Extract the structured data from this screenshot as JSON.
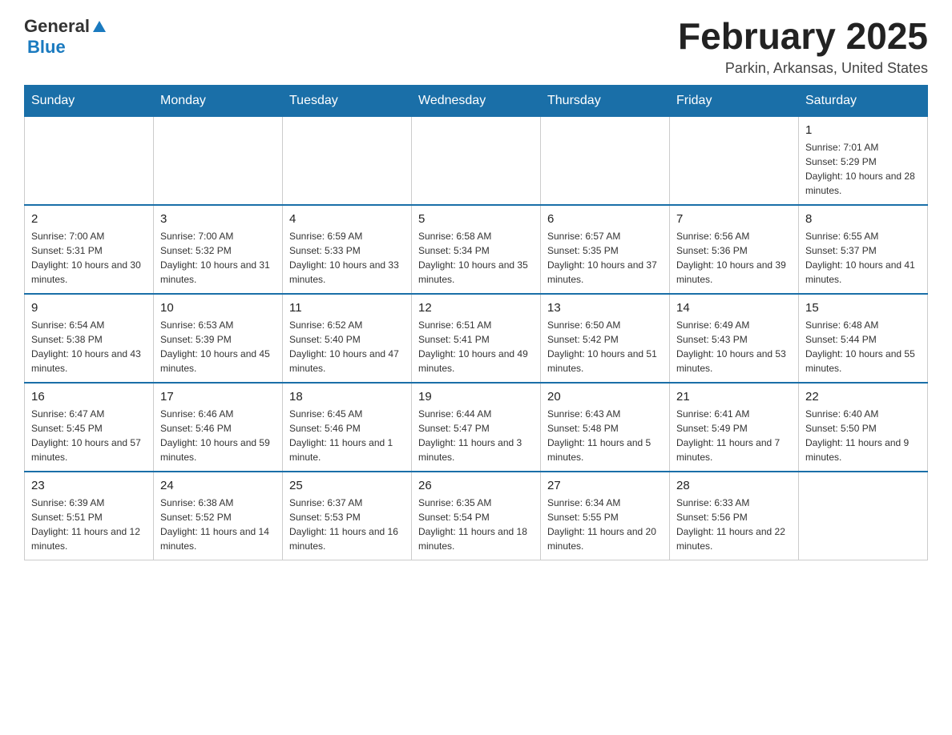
{
  "header": {
    "logo_general": "General",
    "logo_blue": "Blue",
    "month_title": "February 2025",
    "location": "Parkin, Arkansas, United States"
  },
  "days_of_week": [
    "Sunday",
    "Monday",
    "Tuesday",
    "Wednesday",
    "Thursday",
    "Friday",
    "Saturday"
  ],
  "weeks": [
    [
      {
        "day": "",
        "sunrise": "",
        "sunset": "",
        "daylight": ""
      },
      {
        "day": "",
        "sunrise": "",
        "sunset": "",
        "daylight": ""
      },
      {
        "day": "",
        "sunrise": "",
        "sunset": "",
        "daylight": ""
      },
      {
        "day": "",
        "sunrise": "",
        "sunset": "",
        "daylight": ""
      },
      {
        "day": "",
        "sunrise": "",
        "sunset": "",
        "daylight": ""
      },
      {
        "day": "",
        "sunrise": "",
        "sunset": "",
        "daylight": ""
      },
      {
        "day": "1",
        "sunrise": "Sunrise: 7:01 AM",
        "sunset": "Sunset: 5:29 PM",
        "daylight": "Daylight: 10 hours and 28 minutes."
      }
    ],
    [
      {
        "day": "2",
        "sunrise": "Sunrise: 7:00 AM",
        "sunset": "Sunset: 5:31 PM",
        "daylight": "Daylight: 10 hours and 30 minutes."
      },
      {
        "day": "3",
        "sunrise": "Sunrise: 7:00 AM",
        "sunset": "Sunset: 5:32 PM",
        "daylight": "Daylight: 10 hours and 31 minutes."
      },
      {
        "day": "4",
        "sunrise": "Sunrise: 6:59 AM",
        "sunset": "Sunset: 5:33 PM",
        "daylight": "Daylight: 10 hours and 33 minutes."
      },
      {
        "day": "5",
        "sunrise": "Sunrise: 6:58 AM",
        "sunset": "Sunset: 5:34 PM",
        "daylight": "Daylight: 10 hours and 35 minutes."
      },
      {
        "day": "6",
        "sunrise": "Sunrise: 6:57 AM",
        "sunset": "Sunset: 5:35 PM",
        "daylight": "Daylight: 10 hours and 37 minutes."
      },
      {
        "day": "7",
        "sunrise": "Sunrise: 6:56 AM",
        "sunset": "Sunset: 5:36 PM",
        "daylight": "Daylight: 10 hours and 39 minutes."
      },
      {
        "day": "8",
        "sunrise": "Sunrise: 6:55 AM",
        "sunset": "Sunset: 5:37 PM",
        "daylight": "Daylight: 10 hours and 41 minutes."
      }
    ],
    [
      {
        "day": "9",
        "sunrise": "Sunrise: 6:54 AM",
        "sunset": "Sunset: 5:38 PM",
        "daylight": "Daylight: 10 hours and 43 minutes."
      },
      {
        "day": "10",
        "sunrise": "Sunrise: 6:53 AM",
        "sunset": "Sunset: 5:39 PM",
        "daylight": "Daylight: 10 hours and 45 minutes."
      },
      {
        "day": "11",
        "sunrise": "Sunrise: 6:52 AM",
        "sunset": "Sunset: 5:40 PM",
        "daylight": "Daylight: 10 hours and 47 minutes."
      },
      {
        "day": "12",
        "sunrise": "Sunrise: 6:51 AM",
        "sunset": "Sunset: 5:41 PM",
        "daylight": "Daylight: 10 hours and 49 minutes."
      },
      {
        "day": "13",
        "sunrise": "Sunrise: 6:50 AM",
        "sunset": "Sunset: 5:42 PM",
        "daylight": "Daylight: 10 hours and 51 minutes."
      },
      {
        "day": "14",
        "sunrise": "Sunrise: 6:49 AM",
        "sunset": "Sunset: 5:43 PM",
        "daylight": "Daylight: 10 hours and 53 minutes."
      },
      {
        "day": "15",
        "sunrise": "Sunrise: 6:48 AM",
        "sunset": "Sunset: 5:44 PM",
        "daylight": "Daylight: 10 hours and 55 minutes."
      }
    ],
    [
      {
        "day": "16",
        "sunrise": "Sunrise: 6:47 AM",
        "sunset": "Sunset: 5:45 PM",
        "daylight": "Daylight: 10 hours and 57 minutes."
      },
      {
        "day": "17",
        "sunrise": "Sunrise: 6:46 AM",
        "sunset": "Sunset: 5:46 PM",
        "daylight": "Daylight: 10 hours and 59 minutes."
      },
      {
        "day": "18",
        "sunrise": "Sunrise: 6:45 AM",
        "sunset": "Sunset: 5:46 PM",
        "daylight": "Daylight: 11 hours and 1 minute."
      },
      {
        "day": "19",
        "sunrise": "Sunrise: 6:44 AM",
        "sunset": "Sunset: 5:47 PM",
        "daylight": "Daylight: 11 hours and 3 minutes."
      },
      {
        "day": "20",
        "sunrise": "Sunrise: 6:43 AM",
        "sunset": "Sunset: 5:48 PM",
        "daylight": "Daylight: 11 hours and 5 minutes."
      },
      {
        "day": "21",
        "sunrise": "Sunrise: 6:41 AM",
        "sunset": "Sunset: 5:49 PM",
        "daylight": "Daylight: 11 hours and 7 minutes."
      },
      {
        "day": "22",
        "sunrise": "Sunrise: 6:40 AM",
        "sunset": "Sunset: 5:50 PM",
        "daylight": "Daylight: 11 hours and 9 minutes."
      }
    ],
    [
      {
        "day": "23",
        "sunrise": "Sunrise: 6:39 AM",
        "sunset": "Sunset: 5:51 PM",
        "daylight": "Daylight: 11 hours and 12 minutes."
      },
      {
        "day": "24",
        "sunrise": "Sunrise: 6:38 AM",
        "sunset": "Sunset: 5:52 PM",
        "daylight": "Daylight: 11 hours and 14 minutes."
      },
      {
        "day": "25",
        "sunrise": "Sunrise: 6:37 AM",
        "sunset": "Sunset: 5:53 PM",
        "daylight": "Daylight: 11 hours and 16 minutes."
      },
      {
        "day": "26",
        "sunrise": "Sunrise: 6:35 AM",
        "sunset": "Sunset: 5:54 PM",
        "daylight": "Daylight: 11 hours and 18 minutes."
      },
      {
        "day": "27",
        "sunrise": "Sunrise: 6:34 AM",
        "sunset": "Sunset: 5:55 PM",
        "daylight": "Daylight: 11 hours and 20 minutes."
      },
      {
        "day": "28",
        "sunrise": "Sunrise: 6:33 AM",
        "sunset": "Sunset: 5:56 PM",
        "daylight": "Daylight: 11 hours and 22 minutes."
      },
      {
        "day": "",
        "sunrise": "",
        "sunset": "",
        "daylight": ""
      }
    ]
  ]
}
